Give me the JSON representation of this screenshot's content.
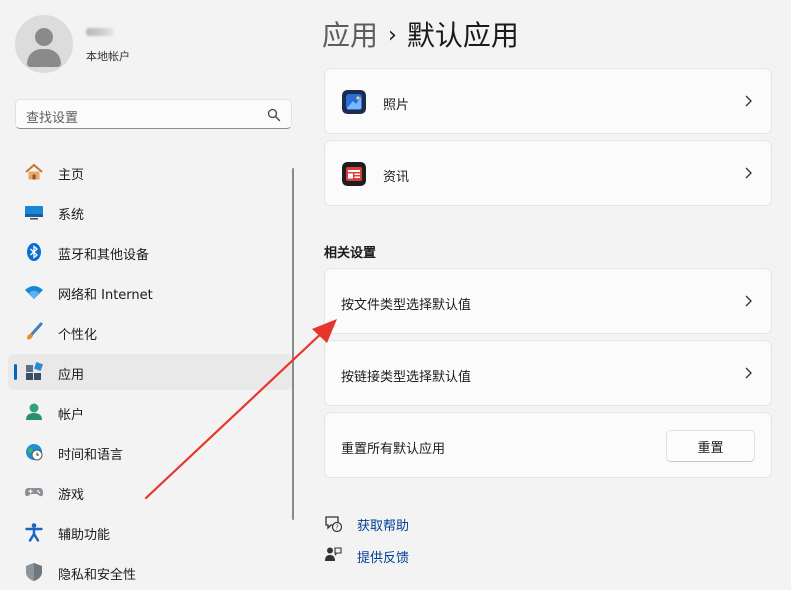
{
  "user": {
    "account_type": "本地帐户"
  },
  "search": {
    "placeholder": "查找设置"
  },
  "nav": [
    {
      "label": "主页",
      "icon": "home-icon"
    },
    {
      "label": "系统",
      "icon": "monitor-icon"
    },
    {
      "label": "蓝牙和其他设备",
      "icon": "bluetooth-icon"
    },
    {
      "label": "网络和 Internet",
      "icon": "wifi-icon"
    },
    {
      "label": "个性化",
      "icon": "brush-icon"
    },
    {
      "label": "应用",
      "icon": "apps-icon",
      "active": true
    },
    {
      "label": "帐户",
      "icon": "person-icon"
    },
    {
      "label": "时间和语言",
      "icon": "globe-clock-icon"
    },
    {
      "label": "游戏",
      "icon": "gamepad-icon"
    },
    {
      "label": "辅助功能",
      "icon": "accessibility-icon"
    },
    {
      "label": "隐私和安全性",
      "icon": "shield-icon"
    }
  ],
  "breadcrumb": {
    "parent": "应用",
    "separator": "›",
    "current": "默认应用"
  },
  "apps": [
    {
      "name": "照片",
      "icon": "photos-icon"
    },
    {
      "name": "资讯",
      "icon": "news-icon"
    }
  ],
  "related": {
    "title": "相关设置",
    "by_file_type": "按文件类型选择默认值",
    "by_link_type": "按链接类型选择默认值",
    "reset_label": "重置所有默认应用",
    "reset_button": "重置"
  },
  "help": {
    "get_help": "获取帮助",
    "feedback": "提供反馈"
  },
  "colors": {
    "accent": "#0067c0",
    "link": "#003e92",
    "annotation_arrow": "#e8352b"
  }
}
